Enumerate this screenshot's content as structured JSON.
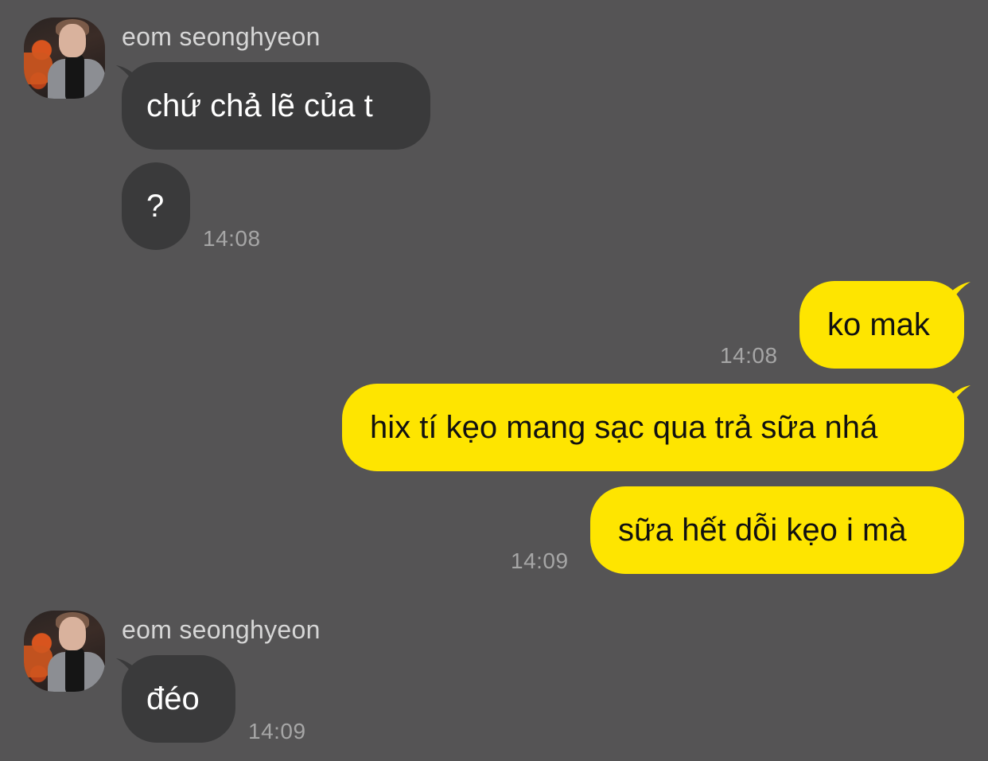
{
  "colors": {
    "background": "#555455",
    "incoming_bubble": "#3a3a3b",
    "outgoing_bubble": "#fee500",
    "timestamp": "#a6a6a6"
  },
  "messages": {
    "group1": {
      "sender": "eom seonghyeon",
      "avatar_icon": "profile-photo",
      "msg1": "chứ chả lẽ của t",
      "msg2": "?",
      "time": "14:08"
    },
    "outgoing": {
      "msg1": "ko mak",
      "time1": "14:08",
      "msg2": "hix tí kẹo mang sạc qua trả sữa nhá",
      "msg3": "sữa hết dỗi kẹo i mà",
      "time3": "14:09"
    },
    "group2": {
      "sender": "eom seonghyeon",
      "avatar_icon": "profile-photo",
      "msg1": "đéo",
      "time": "14:09"
    }
  }
}
